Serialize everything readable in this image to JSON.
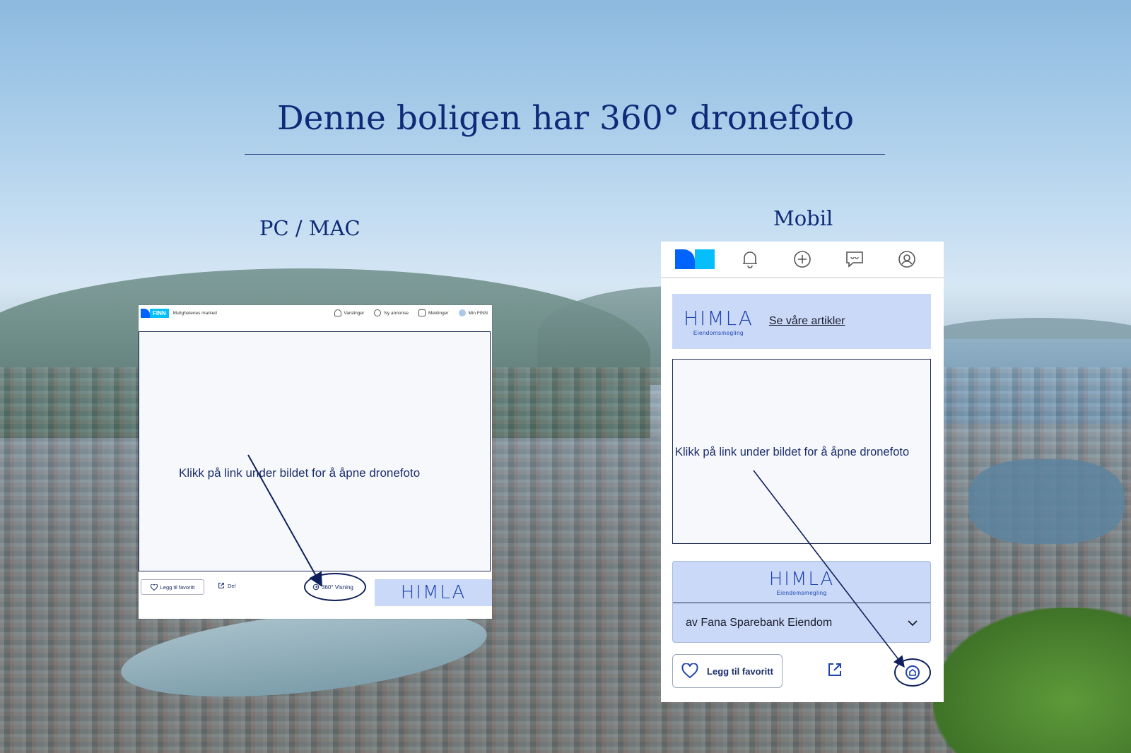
{
  "heading": {
    "title": "Denne boligen har 360° dronefoto",
    "pc_label": "PC / MAC",
    "mobile_label": "Mobil"
  },
  "pc": {
    "brand_logo": "FINN",
    "tagline": "Mulighetenes marked",
    "nav": [
      {
        "label": "Varslinger",
        "icon": "bell-icon"
      },
      {
        "label": "Ny annonse",
        "icon": "plus-circle-icon"
      },
      {
        "label": "Meldinger",
        "icon": "message-icon"
      },
      {
        "label": "Min FINN",
        "icon": "avatar-icon"
      }
    ],
    "hint": "Klikk på link under bildet for å åpne dronefoto",
    "favorite_label": "Legg til favoritt",
    "share_label": "Del",
    "view360_label": "360° Visning",
    "broker_logo": "HIMLA"
  },
  "mobile": {
    "broker_logo": "HIMLA",
    "broker_sub": "Eiendomsmegling",
    "articles_link": "Se våre artikler",
    "hint": "Klikk på link under bildet for å åpne dronefoto",
    "broker_logo2": "HIMLA",
    "broker_sub2": "Eiendomsmegling",
    "broker_by": "av Fana Sparebank Eiendom",
    "favorite_label": "Legg til favoritt"
  },
  "colors": {
    "accent": "#0e2a78",
    "finn_blue": "#0063fb",
    "finn_cyan": "#06befb",
    "brand_panel": "#c9d9f7"
  }
}
